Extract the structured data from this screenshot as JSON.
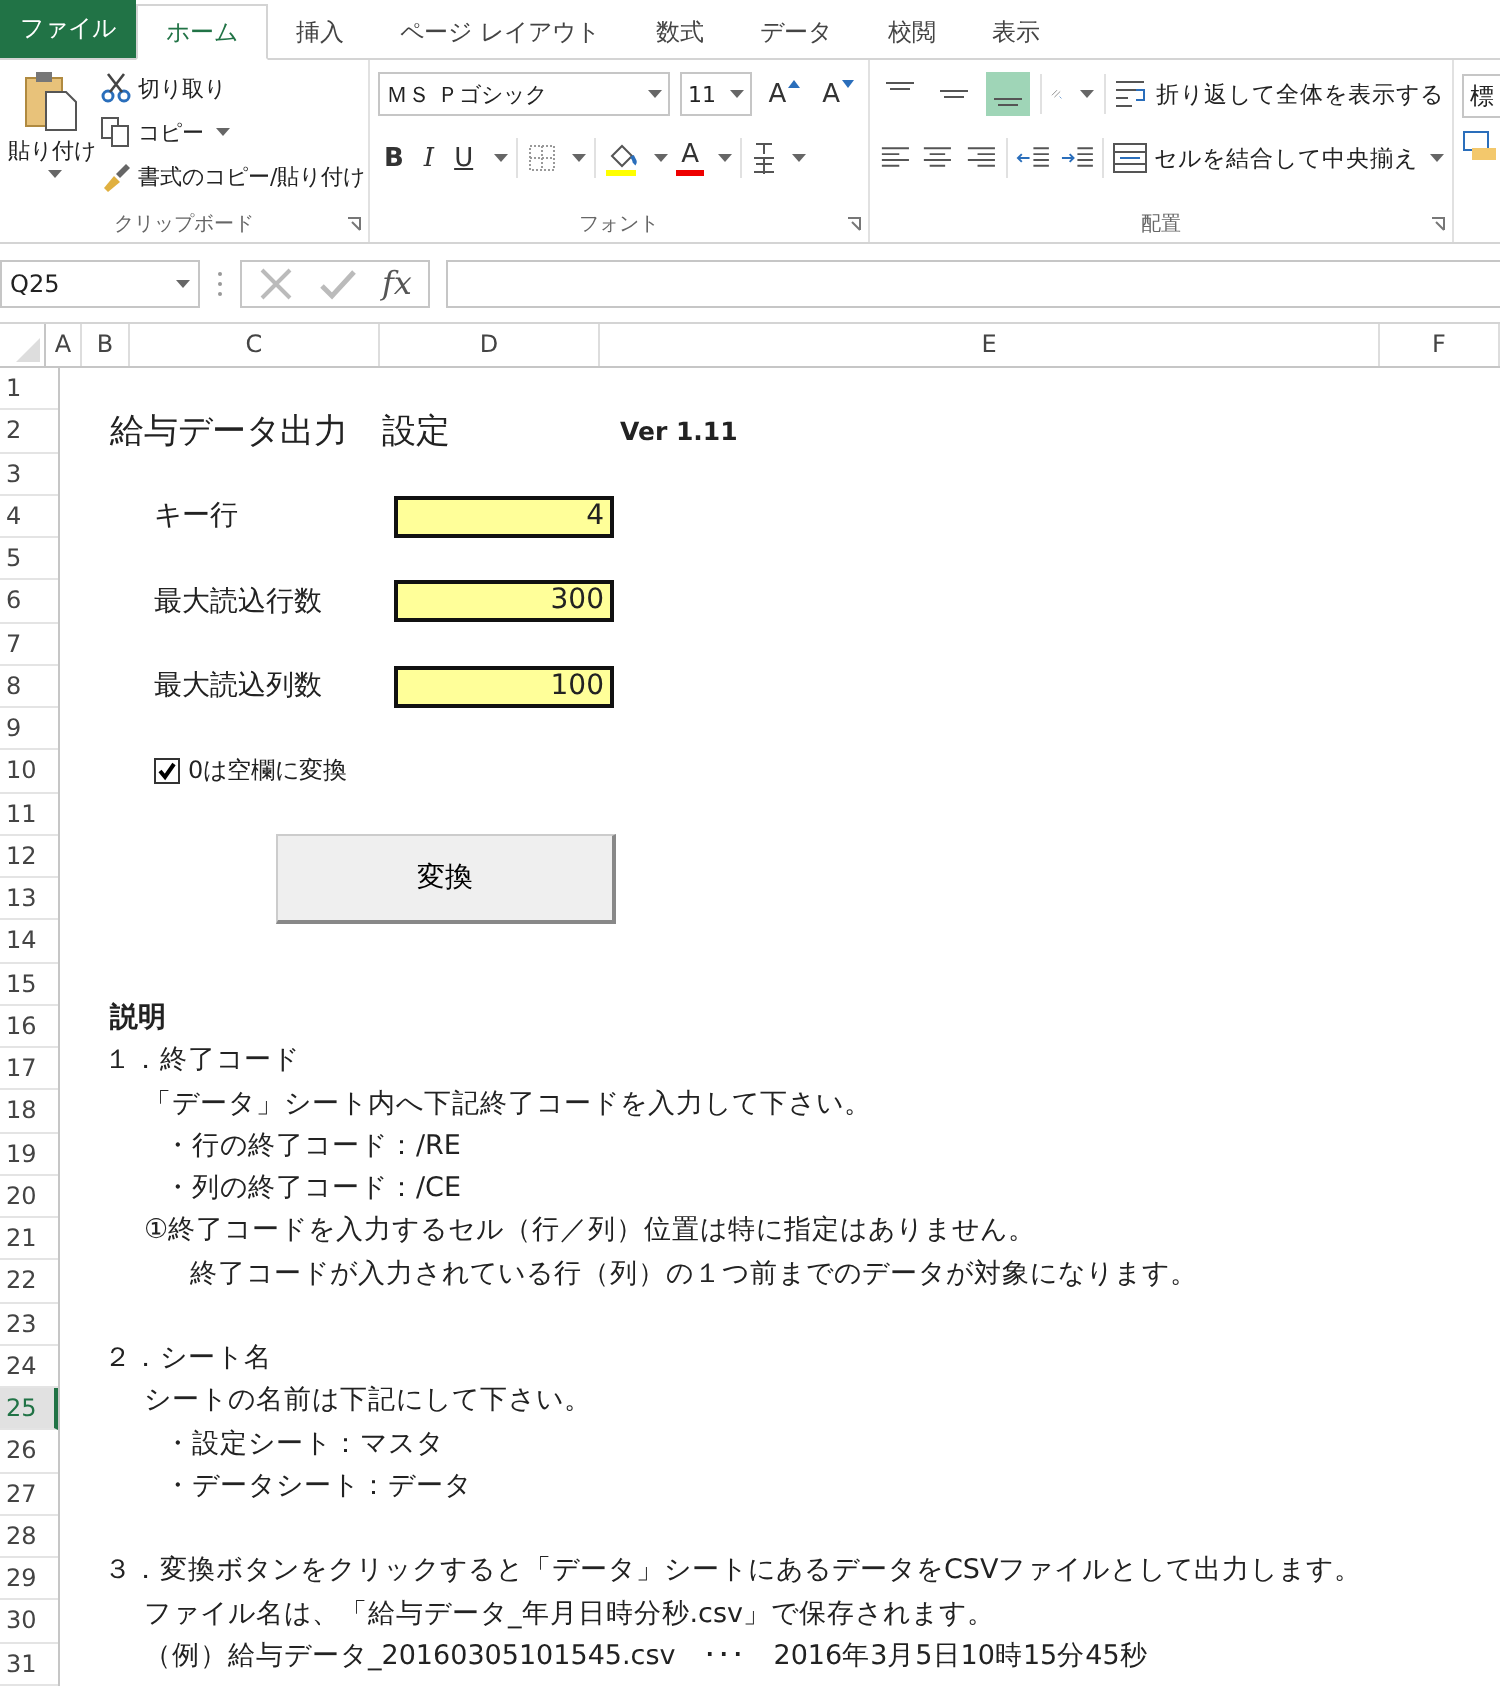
{
  "ribbon_tabs": [
    {
      "label": "ファイル",
      "kind": "file",
      "selected": false
    },
    {
      "label": "ホーム",
      "kind": "tab",
      "selected": true
    },
    {
      "label": "挿入",
      "kind": "tab",
      "selected": false
    },
    {
      "label": "ページ レイアウト",
      "kind": "tab",
      "selected": false
    },
    {
      "label": "数式",
      "kind": "tab",
      "selected": false
    },
    {
      "label": "データ",
      "kind": "tab",
      "selected": false
    },
    {
      "label": "校閲",
      "kind": "tab",
      "selected": false
    },
    {
      "label": "表示",
      "kind": "tab",
      "selected": false
    }
  ],
  "clipboard": {
    "paste": "貼り付け",
    "cut": "切り取り",
    "copy": "コピー",
    "format_painter": "書式のコピー/貼り付け",
    "group_label": "クリップボード"
  },
  "font": {
    "name": "ＭＳ Ｐゴシック",
    "size": "11",
    "grow_label": "A",
    "shrink_label": "A",
    "bold_label": "B",
    "italic_label": "I",
    "underline_label": "U",
    "color_label": "A",
    "group_label": "フォント"
  },
  "alignment": {
    "vertical_align_buttons": [
      {
        "selected": false
      },
      {
        "selected": false
      },
      {
        "selected": true
      }
    ],
    "wrap": "折り返して全体を表示する",
    "merge": "セルを結合して中央揃え",
    "group_label": "配置"
  },
  "number_format": {
    "value": "標"
  },
  "formula_bar": {
    "name_box": "Q25",
    "fx_label": "fx"
  },
  "columns": [
    {
      "label": "A"
    },
    {
      "label": "B"
    },
    {
      "label": "C"
    },
    {
      "label": "D"
    },
    {
      "label": "E"
    },
    {
      "label": "F"
    }
  ],
  "rows": [
    {
      "label": "1",
      "selected": false
    },
    {
      "label": "2",
      "selected": false
    },
    {
      "label": "3",
      "selected": false
    },
    {
      "label": "4",
      "selected": false
    },
    {
      "label": "5",
      "selected": false
    },
    {
      "label": "6",
      "selected": false
    },
    {
      "label": "7",
      "selected": false
    },
    {
      "label": "8",
      "selected": false
    },
    {
      "label": "9",
      "selected": false
    },
    {
      "label": "10",
      "selected": false
    },
    {
      "label": "11",
      "selected": false
    },
    {
      "label": "12",
      "selected": false
    },
    {
      "label": "13",
      "selected": false
    },
    {
      "label": "14",
      "selected": false
    },
    {
      "label": "15",
      "selected": false
    },
    {
      "label": "16",
      "selected": false
    },
    {
      "label": "17",
      "selected": false
    },
    {
      "label": "18",
      "selected": false
    },
    {
      "label": "19",
      "selected": false
    },
    {
      "label": "20",
      "selected": false
    },
    {
      "label": "21",
      "selected": false
    },
    {
      "label": "22",
      "selected": false
    },
    {
      "label": "23",
      "selected": false
    },
    {
      "label": "24",
      "selected": false
    },
    {
      "label": "25",
      "selected": true
    },
    {
      "label": "26",
      "selected": false
    },
    {
      "label": "27",
      "selected": false
    },
    {
      "label": "28",
      "selected": false
    },
    {
      "label": "29",
      "selected": false
    },
    {
      "label": "30",
      "selected": false
    },
    {
      "label": "31",
      "selected": false
    }
  ],
  "sheet": {
    "title": "給与データ出力　設定",
    "version": "Ver 1.11",
    "settings": [
      {
        "label": "キー行",
        "value": "4"
      },
      {
        "label": "最大読込行数",
        "value": "300"
      },
      {
        "label": "最大読込列数",
        "value": "100"
      }
    ],
    "checkbox": {
      "label": "0は空欄に変換",
      "checked": true
    },
    "convert_button": "変換",
    "description_heading": "説明",
    "description": [
      {
        "kind": "item",
        "text": "１．終了コード"
      },
      {
        "kind": "text",
        "text": "「データ」シート内へ下記終了コードを入力して下さい。"
      },
      {
        "kind": "bullet",
        "text": "・行の終了コード：/RE"
      },
      {
        "kind": "bullet",
        "text": "・列の終了コード：/CE"
      },
      {
        "kind": "text",
        "text": "①終了コードを入力するセル（行／列）位置は特に指定はありません。"
      },
      {
        "kind": "note",
        "text": "終了コードが入力されている行（列）の１つ前までのデータが対象になります。"
      },
      {
        "kind": "item",
        "text": "２．シート名"
      },
      {
        "kind": "text",
        "text": "シートの名前は下記にして下さい。"
      },
      {
        "kind": "bullet",
        "text": "・設定シート：マスタ"
      },
      {
        "kind": "bullet",
        "text": "・データシート：データ"
      },
      {
        "kind": "item",
        "text": "３．変換ボタンをクリックすると「データ」シートにあるデータをCSVファイルとして出力します。"
      },
      {
        "kind": "text",
        "text": "ファイル名は、「給与データ_年月日時分秒.csv」で保存されます。"
      },
      {
        "kind": "text",
        "text": "（例）給与データ_20160305101545.csv　･･･　2016年3月5日10時15分45秒"
      }
    ]
  }
}
